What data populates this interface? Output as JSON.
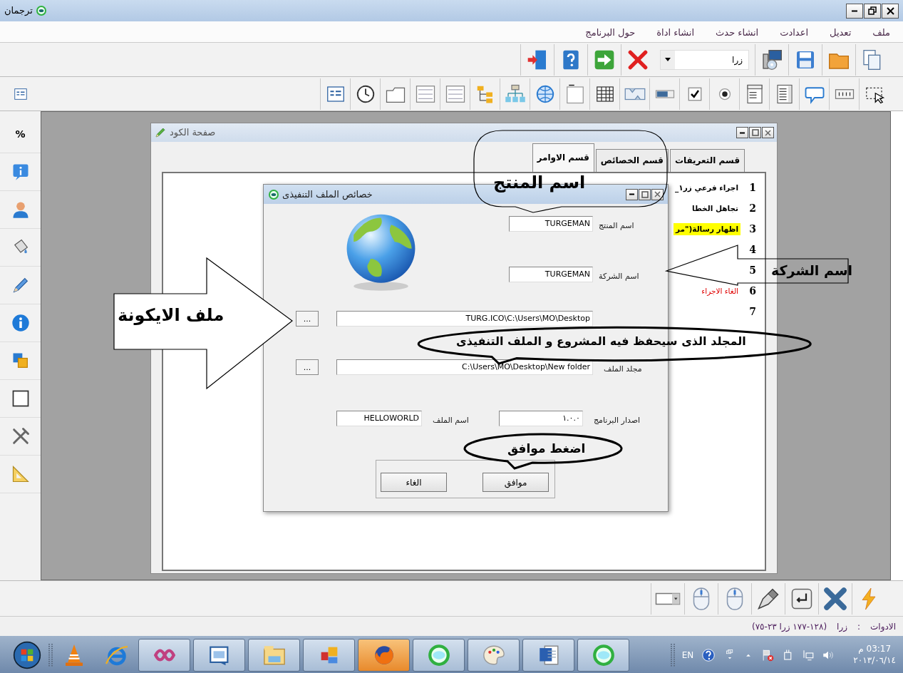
{
  "window": {
    "title": "ترجمان"
  },
  "menu": [
    "ملف",
    "تعديل",
    "اعدادت",
    "انشاء حدث",
    "انشاء اداة",
    "حول البرنامج"
  ],
  "toolbar": {
    "combo_value": "زرا"
  },
  "tool_palette": {
    "percent_label": "%"
  },
  "code_window": {
    "title": "صفحة الكود",
    "tabs": [
      {
        "label": "قسم التعريفات",
        "selected": false
      },
      {
        "label": "قسم الخصائص",
        "selected": false
      },
      {
        "label": "قسم الاوامر",
        "selected": true
      }
    ],
    "lines": [
      {
        "number": "1",
        "text": "اجراء فرعي زر١_",
        "kind": "plain"
      },
      {
        "number": "2",
        "text": "تجاهل الخطا",
        "kind": "plain"
      },
      {
        "number": "3",
        "text": "اظهار رسالة(\"مر",
        "kind": "highlight"
      },
      {
        "number": "4"
      },
      {
        "number": "5"
      },
      {
        "number": "6",
        "text": "الغاء الاجراء",
        "kind": "error"
      },
      {
        "number": "7"
      }
    ]
  },
  "dialog": {
    "title": "خصائص الملف التنفيذى",
    "product_name": {
      "label": "اسم المنتج",
      "value": "TURGEMAN"
    },
    "company": {
      "label": "اسم الشركة",
      "value": "TURGEMAN"
    },
    "icon_file": {
      "value": "TURG.ICO\\C:\\Users\\MO\\Desktop",
      "browse": "..."
    },
    "output_folder": {
      "label": "مجلد الملف",
      "value": "C:\\Users\\MO\\Desktop\\New folder",
      "browse": "..."
    },
    "file_name": {
      "label": "اسم الملف",
      "value": "HELLOWORLD"
    },
    "version": {
      "label": "اصدار البرنامج",
      "value": "١.٠.٠"
    },
    "buttons": [
      "موافق",
      "الغاء"
    ]
  },
  "annotations": [
    {
      "kind": "bubble",
      "text": "اسم المنتج"
    },
    {
      "kind": "arrow_left",
      "text": "اسم الشركة"
    },
    {
      "kind": "arrow_right",
      "text": "ملف الايكونة"
    },
    {
      "kind": "ellipse",
      "text": "المجلد الذى سيحفظ فيه المشروع و الملف التنفيذى"
    },
    {
      "kind": "ellipse",
      "text": "اضغط موافق"
    }
  ],
  "status_bar": {
    "label": "الادوات",
    "separator": ":",
    "control": "زرا",
    "bounds": "(١٢٨-١٧٧ زرا ٢٣-٧٥)"
  },
  "taskbar": {
    "language": "EN",
    "time": "03:17 م",
    "date": "٢٠١٣/٠٦/١٤"
  }
}
